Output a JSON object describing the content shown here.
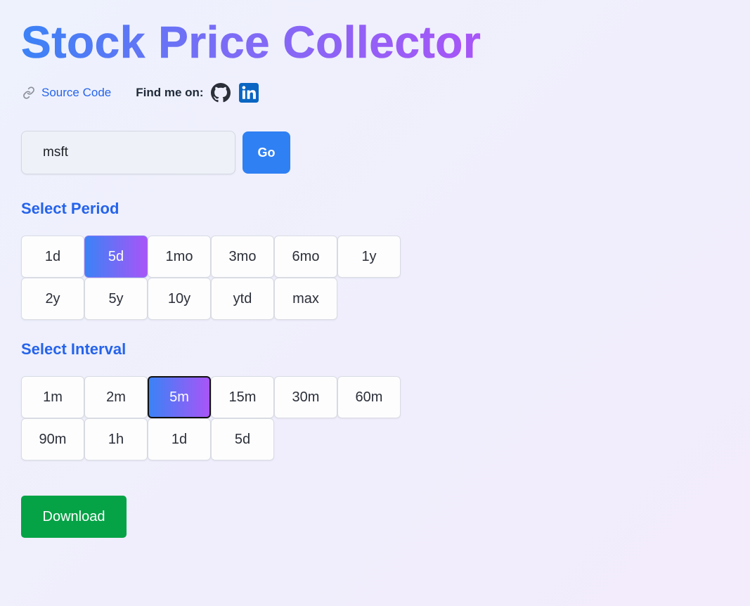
{
  "header": {
    "title": "Stock Price Collector"
  },
  "links": {
    "source_code_label": "Source Code",
    "find_me_label": "Find me on:",
    "link_icon": "link-icon",
    "github_icon": "github-icon",
    "linkedin_icon": "linkedin-icon"
  },
  "search": {
    "value": "msft",
    "go_label": "Go"
  },
  "period": {
    "label": "Select Period",
    "options": [
      "1d",
      "5d",
      "1mo",
      "3mo",
      "6mo",
      "1y",
      "2y",
      "5y",
      "10y",
      "ytd",
      "max"
    ],
    "selected": "5d"
  },
  "interval": {
    "label": "Select Interval",
    "options": [
      "1m",
      "2m",
      "5m",
      "15m",
      "30m",
      "60m",
      "90m",
      "1h",
      "1d",
      "5d"
    ],
    "selected": "5m"
  },
  "download": {
    "label": "Download"
  },
  "colors": {
    "accent": "#2563eb",
    "go_button": "#2f80f3",
    "download_button": "#05a346",
    "gradient_start": "#3b82f6",
    "gradient_end": "#a855f7"
  }
}
